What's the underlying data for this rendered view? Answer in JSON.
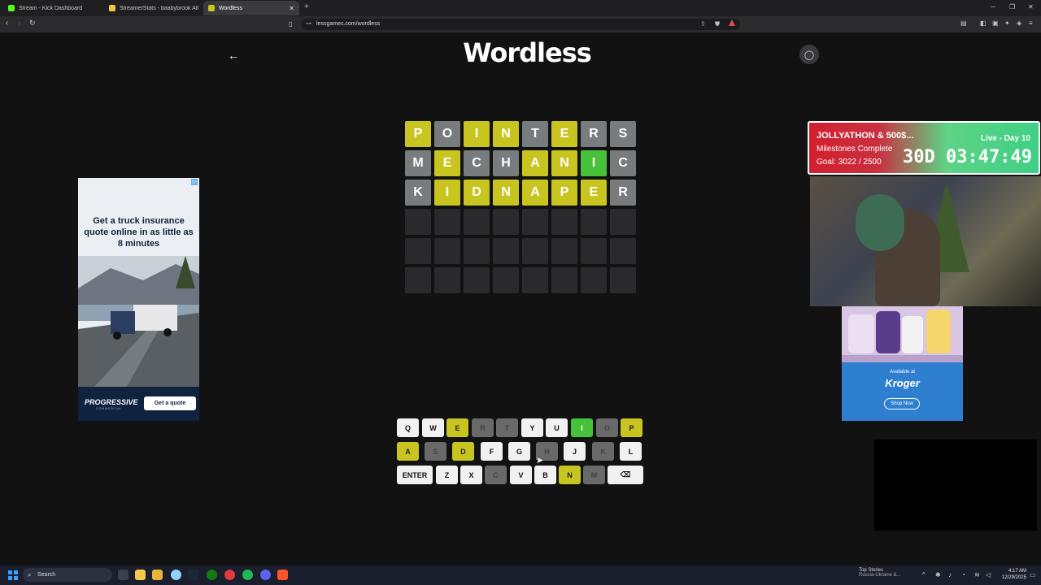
{
  "browser": {
    "tabs": [
      {
        "label": "Stream - Kick Dashboard",
        "color": "#53fc18"
      },
      {
        "label": "StreamerStats - baabybrook All Time",
        "color": "#f5c542"
      },
      {
        "label": "Wordless",
        "color": "#c9c520"
      }
    ],
    "new_tab": "+",
    "url": "lessgames.com/wordless"
  },
  "page": {
    "logo": "Wordless",
    "back_icon": "arrow-left-icon",
    "profile_icon": "user-icon"
  },
  "board": {
    "rows": [
      [
        {
          "l": "P",
          "s": "yellow"
        },
        {
          "l": "O",
          "s": "gray"
        },
        {
          "l": "I",
          "s": "yellow"
        },
        {
          "l": "N",
          "s": "yellow"
        },
        {
          "l": "T",
          "s": "gray"
        },
        {
          "l": "E",
          "s": "yellow"
        },
        {
          "l": "R",
          "s": "gray"
        },
        {
          "l": "S",
          "s": "gray"
        }
      ],
      [
        {
          "l": "M",
          "s": "gray"
        },
        {
          "l": "E",
          "s": "yellow"
        },
        {
          "l": "C",
          "s": "gray"
        },
        {
          "l": "H",
          "s": "gray"
        },
        {
          "l": "A",
          "s": "yellow"
        },
        {
          "l": "N",
          "s": "yellow"
        },
        {
          "l": "I",
          "s": "green"
        },
        {
          "l": "C",
          "s": "gray"
        }
      ],
      [
        {
          "l": "K",
          "s": "gray"
        },
        {
          "l": "I",
          "s": "yellow"
        },
        {
          "l": "D",
          "s": "yellow"
        },
        {
          "l": "N",
          "s": "yellow"
        },
        {
          "l": "A",
          "s": "yellow"
        },
        {
          "l": "P",
          "s": "yellow"
        },
        {
          "l": "E",
          "s": "yellow"
        },
        {
          "l": "R",
          "s": "gray"
        }
      ],
      [
        {
          "l": "",
          "s": "empty"
        },
        {
          "l": "",
          "s": "empty"
        },
        {
          "l": "",
          "s": "empty"
        },
        {
          "l": "",
          "s": "empty"
        },
        {
          "l": "",
          "s": "empty"
        },
        {
          "l": "",
          "s": "empty"
        },
        {
          "l": "",
          "s": "empty"
        },
        {
          "l": "",
          "s": "empty"
        }
      ],
      [
        {
          "l": "",
          "s": "empty"
        },
        {
          "l": "",
          "s": "empty"
        },
        {
          "l": "",
          "s": "empty"
        },
        {
          "l": "",
          "s": "empty"
        },
        {
          "l": "",
          "s": "empty"
        },
        {
          "l": "",
          "s": "empty"
        },
        {
          "l": "",
          "s": "empty"
        },
        {
          "l": "",
          "s": "empty"
        }
      ],
      [
        {
          "l": "",
          "s": "empty"
        },
        {
          "l": "",
          "s": "empty"
        },
        {
          "l": "",
          "s": "empty"
        },
        {
          "l": "",
          "s": "empty"
        },
        {
          "l": "",
          "s": "empty"
        },
        {
          "l": "",
          "s": "empty"
        },
        {
          "l": "",
          "s": "empty"
        },
        {
          "l": "",
          "s": "empty"
        }
      ]
    ]
  },
  "keyboard": {
    "rows": [
      [
        {
          "k": "Q",
          "s": "white"
        },
        {
          "k": "W",
          "s": "white"
        },
        {
          "k": "E",
          "s": "yellow"
        },
        {
          "k": "R",
          "s": "gray"
        },
        {
          "k": "T",
          "s": "gray"
        },
        {
          "k": "Y",
          "s": "white"
        },
        {
          "k": "U",
          "s": "white"
        },
        {
          "k": "I",
          "s": "green"
        },
        {
          "k": "O",
          "s": "gray"
        },
        {
          "k": "P",
          "s": "yellow"
        }
      ],
      [
        {
          "k": "A",
          "s": "yellow"
        },
        {
          "k": "S",
          "s": "gray"
        },
        {
          "k": "D",
          "s": "yellow"
        },
        {
          "k": "F",
          "s": "white"
        },
        {
          "k": "G",
          "s": "white"
        },
        {
          "k": "H",
          "s": "gray"
        },
        {
          "k": "J",
          "s": "white"
        },
        {
          "k": "K",
          "s": "gray"
        },
        {
          "k": "L",
          "s": "white"
        }
      ],
      [
        {
          "k": "ENTER",
          "s": "white",
          "wide": true
        },
        {
          "k": "Z",
          "s": "white"
        },
        {
          "k": "X",
          "s": "white"
        },
        {
          "k": "C",
          "s": "gray"
        },
        {
          "k": "V",
          "s": "white"
        },
        {
          "k": "B",
          "s": "white"
        },
        {
          "k": "N",
          "s": "yellow"
        },
        {
          "k": "M",
          "s": "gray"
        },
        {
          "k": "⌫",
          "s": "white",
          "wide": true
        }
      ]
    ]
  },
  "ads": {
    "left": {
      "headline": "Get a truck insurance quote online in as little as 8 minutes",
      "brand": "PROGRESSIVE",
      "brand_sub": "COMMERCIAL",
      "cta": "Get a quote"
    },
    "right": {
      "available": "Available at",
      "store": "Kroger",
      "cta": "Shop Now"
    }
  },
  "stream_overlay": {
    "title": "JOLLYATHON & 500$...",
    "milestones": "Milestones Complete",
    "goal": "Goal: 3022 / 2500",
    "live": "Live - Day 10",
    "timer": "30D 03:47:49"
  },
  "taskbar": {
    "search_placeholder": "Search",
    "news_title": "Top Stories",
    "news_sub": "Russia-Ukraine &...",
    "time": "4:17 AM",
    "date": "12/29/2025"
  }
}
